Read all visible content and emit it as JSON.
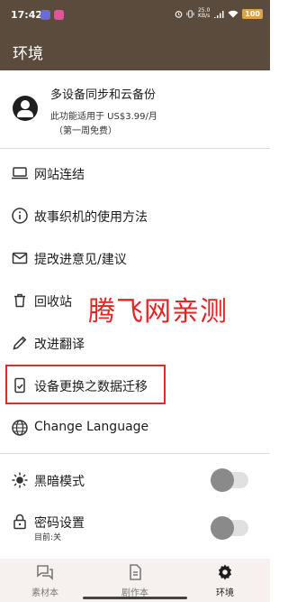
{
  "status_bar": {
    "time": "17:42",
    "speed_value": "25.0",
    "speed_unit": "KB/s",
    "battery": "100"
  },
  "app_bar": {
    "title": "环境"
  },
  "account": {
    "title": "多设备同步和云备份",
    "subtitle": "此功能适用于 US$3.99/月",
    "note": "（第一周免费）"
  },
  "menu": {
    "website_link": "网站连结",
    "usage_guide": "故事织机的使用方法",
    "feedback": "提改进意见/建议",
    "recycle_bin": "回收站",
    "improve_translation": "改进翻译",
    "data_migration": "设备更换之数据迁移",
    "change_language": "Change Language"
  },
  "settings": {
    "dark_mode_label": "黑暗模式",
    "dark_mode_on": false,
    "password_label": "密码设置",
    "password_status": "目前:关",
    "password_on": false
  },
  "watermark": "腾飞网亲测",
  "bottom_nav": {
    "items": [
      {
        "label": "素材本",
        "icon": "forum-icon"
      },
      {
        "label": "剧作本",
        "icon": "document-icon"
      },
      {
        "label": "环境",
        "icon": "gear-icon"
      }
    ],
    "active_index": 2
  },
  "colors": {
    "app_bar": "#5b4b3d",
    "highlight": "#e22b2b",
    "nav_background": "#f6f1ef"
  }
}
